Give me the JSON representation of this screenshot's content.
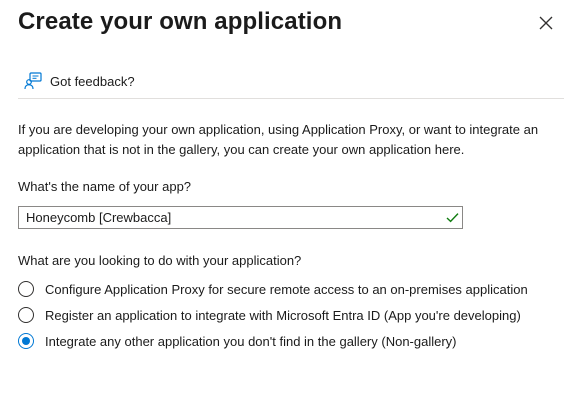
{
  "dialog": {
    "title": "Create your own application",
    "close_icon": "close-icon"
  },
  "feedback": {
    "label": "Got feedback?",
    "icon": "feedback-icon"
  },
  "intro_text": "If you are developing your own application, using Application Proxy, or want to integrate an application that is not in the gallery, you can create your own application here.",
  "app_name": {
    "label": "What's the name of your app?",
    "value": "Honeycomb [Crewbacca]",
    "validation_icon": "checkmark-icon"
  },
  "purpose": {
    "question": "What are you looking to do with your application?",
    "selected_index": 2,
    "options": [
      {
        "label": "Configure Application Proxy for secure remote access to an on-premises application",
        "checked": false
      },
      {
        "label": "Register an application to integrate with Microsoft Entra ID (App you're developing)",
        "checked": false
      },
      {
        "label": "Integrate any other application you don't find in the gallery (Non-gallery)",
        "checked": true
      }
    ]
  },
  "colors": {
    "accent": "#0078d4",
    "valid": "#107c10",
    "text": "#1b1b1b",
    "border": "#8a8886",
    "divider": "#e1dfdd"
  }
}
